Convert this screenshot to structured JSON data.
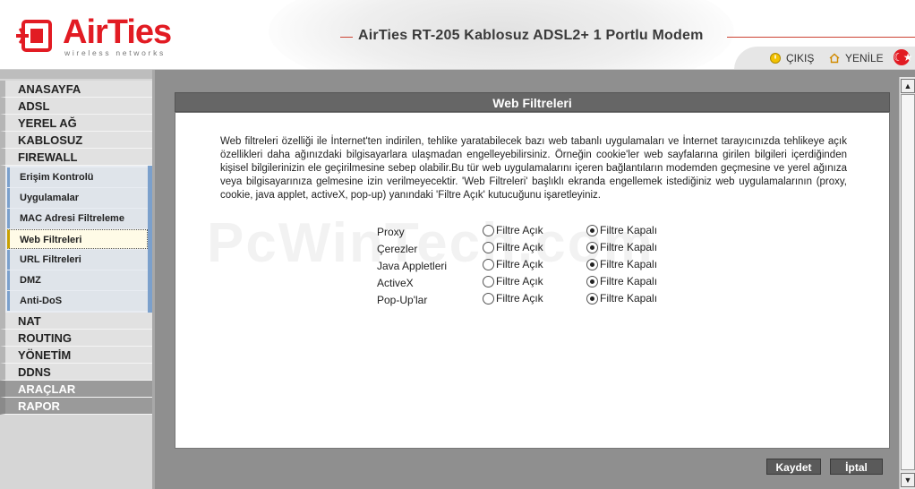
{
  "header": {
    "brand": "AirTies",
    "brand_sub": "wireless networks",
    "model_title": "AirTies RT-205 Kablosuz ADSL2+ 1 Portlu Modem",
    "logout_label": "ÇIKIŞ",
    "refresh_label": "YENİLE",
    "flag_symbol": "☾★"
  },
  "sidebar": {
    "items_top": [
      {
        "label": "ANASAYFA"
      },
      {
        "label": "ADSL"
      },
      {
        "label": "YEREL AĞ"
      },
      {
        "label": "KABLOSUZ"
      },
      {
        "label": "FIREWALL"
      }
    ],
    "firewall_sub": [
      {
        "label": "Erişim Kontrolü"
      },
      {
        "label": "Uygulamalar"
      },
      {
        "label": "MAC Adresi Filtreleme"
      },
      {
        "label": "Web Filtreleri"
      },
      {
        "label": "URL Filtreleri"
      },
      {
        "label": "DMZ"
      },
      {
        "label": "Anti-DoS"
      }
    ],
    "items_bottom": [
      {
        "label": "NAT"
      },
      {
        "label": "ROUTING"
      },
      {
        "label": "YÖNETİM"
      },
      {
        "label": "DDNS"
      },
      {
        "label": "ARAÇLAR"
      },
      {
        "label": "RAPOR"
      }
    ]
  },
  "main": {
    "title": "Web Filtreleri",
    "description": "Web filtreleri özelliği ile İnternet'ten indirilen, tehlike yaratabilecek bazı web tabanlı uygulamaları ve İnternet tarayıcınızda tehlikeye açık özellikleri daha ağınızdaki bilgisayarlara ulaşmadan engelleyebilirsiniz. Örneğin cookie'ler web sayfalarına girilen bilgileri içerdiğinden kişisel bilgilerinizin ele geçirilmesine sebep olabilir.Bu tür web uygulamalarını içeren bağlantıların modemden geçmesine ve yerel ağınıza veya bilgisayarınıza gelmesine izin verilmeyecektir. 'Web Filtreleri' başlıklı ekranda engellemek istediğiniz web uygulamalarının (proxy, cookie, java applet, activeX, pop-up) yanındaki 'Filtre Açık' kutucuğunu işaretleyiniz.",
    "watermark": "PcWinTech.com",
    "option_on_label": "Filtre Açık",
    "option_off_label": "Filtre Kapalı",
    "filters": [
      {
        "label": "Proxy",
        "state": "off"
      },
      {
        "label": "Çerezler",
        "state": "off"
      },
      {
        "label": "Java Appletleri",
        "state": "off"
      },
      {
        "label": "ActiveX",
        "state": "off"
      },
      {
        "label": "Pop-Up'lar",
        "state": "off"
      }
    ],
    "save_label": "Kaydet",
    "cancel_label": "İptal"
  },
  "scrollbar": {
    "up_glyph": "▲",
    "down_glyph": "▼"
  },
  "colors": {
    "brand_red": "#e21b23",
    "panel_title_bg": "#666666",
    "button_bg": "#5a5a5a",
    "submenu_accent": "#7ba0cc",
    "active_accent": "#c8a000"
  }
}
